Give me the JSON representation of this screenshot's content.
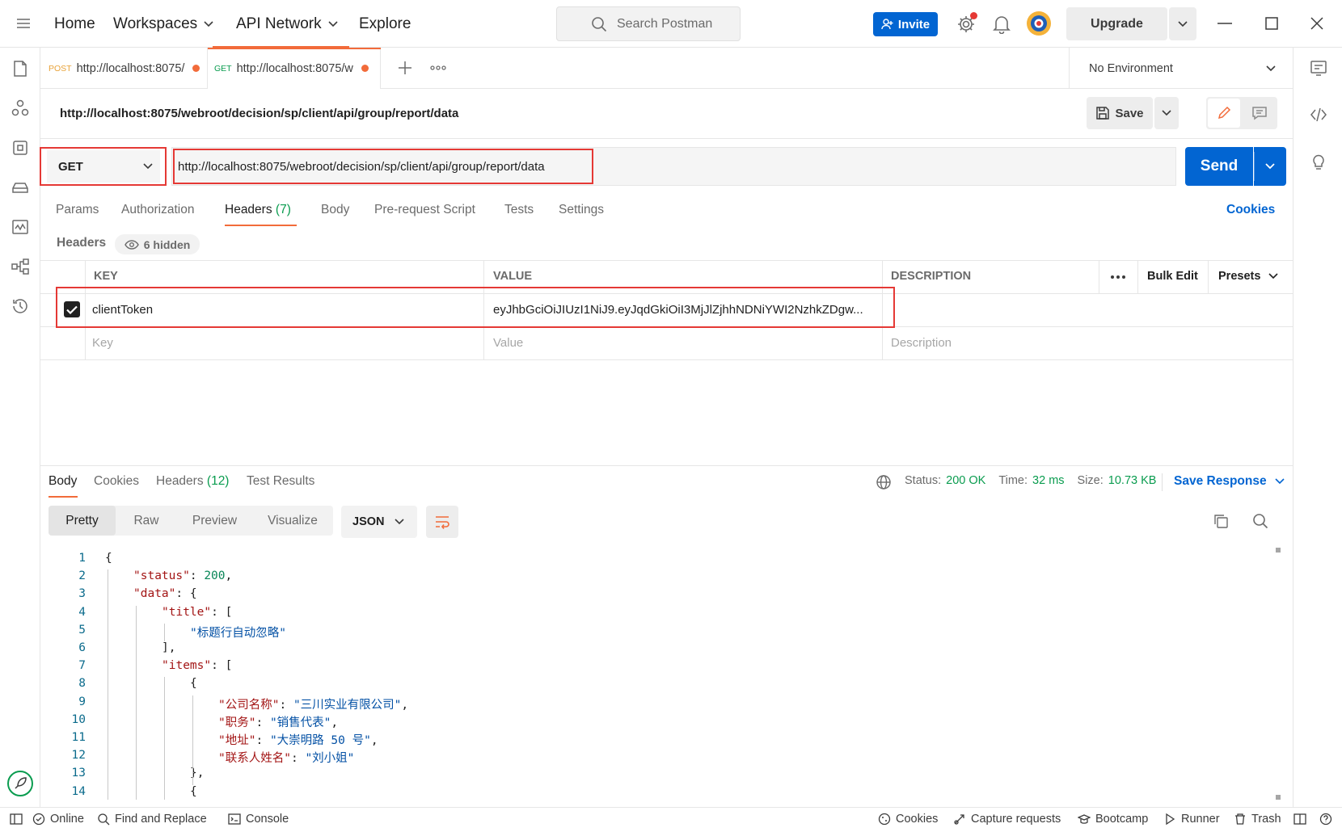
{
  "topbar": {
    "nav": [
      "Home",
      "Workspaces",
      "API Network",
      "Explore"
    ],
    "search_placeholder": "Search Postman",
    "invite_label": "Invite",
    "upgrade_label": "Upgrade"
  },
  "tabs": [
    {
      "method": "POST",
      "title": "http://localhost:8075/",
      "method_color": "#e8a33a"
    },
    {
      "method": "GET",
      "title": "http://localhost:8075/w",
      "method_color": "#0a9c4f"
    }
  ],
  "environment": "No Environment",
  "request": {
    "title": "http://localhost:8075/webroot/decision/sp/client/api/group/report/data",
    "method": "GET",
    "url": "http://localhost:8075/webroot/decision/sp/client/api/group/report/data",
    "save_label": "Save",
    "send_label": "Send",
    "tabs": [
      "Params",
      "Authorization",
      "Headers",
      "Body",
      "Pre-request Script",
      "Tests",
      "Settings"
    ],
    "headers_count": "(7)",
    "cookies_label": "Cookies"
  },
  "headers_section": {
    "label": "Headers",
    "hidden_label": "6 hidden",
    "columns": [
      "KEY",
      "VALUE",
      "DESCRIPTION"
    ],
    "bulk_edit_label": "Bulk Edit",
    "presets_label": "Presets",
    "rows": [
      {
        "key": "clientToken",
        "value": "eyJhbGciOiJIUzI1NiJ9.eyJqdGkiOiI3MjJlZjhhNDNiYWI2NzhkZDgw...",
        "description": "",
        "checked": true
      }
    ],
    "placeholders": {
      "key": "Key",
      "value": "Value",
      "description": "Description"
    }
  },
  "response": {
    "tabs": [
      "Body",
      "Cookies",
      "Headers",
      "Test Results"
    ],
    "headers_count": "(12)",
    "status_label": "Status:",
    "status_value": "200 OK",
    "time_label": "Time:",
    "time_value": "32 ms",
    "size_label": "Size:",
    "size_value": "10.73 KB",
    "save_response_label": "Save Response",
    "view_tabs": [
      "Pretty",
      "Raw",
      "Preview",
      "Visualize"
    ],
    "format": "JSON",
    "code_lines": [
      {
        "n": "1",
        "indent": 0,
        "parts": [
          [
            "p",
            "{"
          ]
        ]
      },
      {
        "n": "2",
        "indent": 1,
        "parts": [
          [
            "k",
            "\"status\""
          ],
          [
            "p",
            ": "
          ],
          [
            "n",
            "200"
          ],
          [
            "p",
            ","
          ]
        ]
      },
      {
        "n": "3",
        "indent": 1,
        "parts": [
          [
            "k",
            "\"data\""
          ],
          [
            "p",
            ": {"
          ]
        ]
      },
      {
        "n": "4",
        "indent": 2,
        "parts": [
          [
            "k",
            "\"title\""
          ],
          [
            "p",
            ": ["
          ]
        ]
      },
      {
        "n": "5",
        "indent": 3,
        "parts": [
          [
            "s",
            "\"标题行自动忽略\""
          ]
        ]
      },
      {
        "n": "6",
        "indent": 2,
        "parts": [
          [
            "p",
            "],"
          ]
        ]
      },
      {
        "n": "7",
        "indent": 2,
        "parts": [
          [
            "k",
            "\"items\""
          ],
          [
            "p",
            ": ["
          ]
        ]
      },
      {
        "n": "8",
        "indent": 3,
        "parts": [
          [
            "p",
            "{"
          ]
        ]
      },
      {
        "n": "9",
        "indent": 4,
        "parts": [
          [
            "k",
            "\"公司名称\""
          ],
          [
            "p",
            ": "
          ],
          [
            "s",
            "\"三川实业有限公司\""
          ],
          [
            "p",
            ","
          ]
        ]
      },
      {
        "n": "10",
        "indent": 4,
        "parts": [
          [
            "k",
            "\"职务\""
          ],
          [
            "p",
            ": "
          ],
          [
            "s",
            "\"销售代表\""
          ],
          [
            "p",
            ","
          ]
        ]
      },
      {
        "n": "11",
        "indent": 4,
        "parts": [
          [
            "k",
            "\"地址\""
          ],
          [
            "p",
            ": "
          ],
          [
            "s",
            "\"大崇明路 50 号\""
          ],
          [
            "p",
            ","
          ]
        ]
      },
      {
        "n": "12",
        "indent": 4,
        "parts": [
          [
            "k",
            "\"联系人姓名\""
          ],
          [
            "p",
            ": "
          ],
          [
            "s",
            "\"刘小姐\""
          ]
        ]
      },
      {
        "n": "13",
        "indent": 3,
        "parts": [
          [
            "p",
            "},"
          ]
        ]
      },
      {
        "n": "14",
        "indent": 3,
        "parts": [
          [
            "p",
            "{"
          ]
        ]
      }
    ]
  },
  "statusbar": {
    "online": "Online",
    "find_replace": "Find and Replace",
    "console": "Console",
    "cookies": "Cookies",
    "capture": "Capture requests",
    "bootcamp": "Bootcamp",
    "runner": "Runner",
    "trash": "Trash"
  },
  "colors": {
    "accent": "#f26b3a",
    "primary": "#0265d2",
    "success": "#0a9c4f",
    "highlight_border": "#e53935"
  },
  "icons": [
    "menu-icon",
    "search-icon",
    "settings-icon",
    "bell-icon",
    "avatar",
    "collections-icon",
    "apis-icon",
    "environments-icon",
    "mock-servers-icon",
    "monitors-icon",
    "flows-icon",
    "history-icon",
    "code-icon",
    "bulb-icon",
    "eye-icon",
    "copy-icon",
    "wrap-icon",
    "globe-icon"
  ]
}
